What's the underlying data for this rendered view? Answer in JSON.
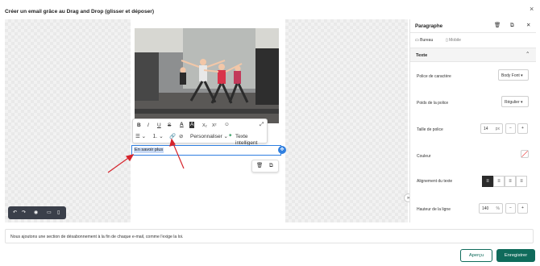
{
  "modal": {
    "title": "Créer un email grâce au Drag and Drop (glisser et déposer)",
    "close_icon": "×"
  },
  "editor": {
    "link_text": "En savoir plus",
    "toolbar": {
      "row1": [
        "B",
        "I",
        "U",
        "S",
        "A",
        "A",
        "X₂",
        "X²",
        "☺",
        "⤢"
      ],
      "personnaliser": "Personnaliser",
      "texte_intelligent": "Texte intelligent",
      "icons_row1": [
        "bold-icon",
        "italic-icon",
        "underline-icon",
        "strikethrough-icon",
        "text-color-icon",
        "highlight-icon",
        "subscript-icon",
        "superscript-icon",
        "emoji-icon",
        "expand-icon"
      ],
      "icons_row2": [
        "list-icon",
        "ordered-list-icon",
        "link-icon",
        "unlink-icon",
        "magic-wand-icon"
      ]
    }
  },
  "view_toggle": {
    "icons": [
      "undo-icon",
      "redo-icon",
      "preview-eye-icon",
      "desktop-icon",
      "mobile-icon"
    ]
  },
  "panel": {
    "title": "Paragraphe",
    "tabs": {
      "bureau": "Bureau",
      "mobile": "Mobile"
    },
    "section": "Texte",
    "fields": {
      "police": {
        "label": "Police de caractère",
        "value": "Body Font"
      },
      "poids": {
        "label": "Poids de la police",
        "value": "Régulier"
      },
      "taille": {
        "label": "Taille de police",
        "value": "14",
        "unit": "px"
      },
      "couleur": {
        "label": "Couleur"
      },
      "alignement": {
        "label": "Alignement du texte"
      },
      "hauteur": {
        "label": "Hauteur de la ligne",
        "value": "140",
        "unit": "%"
      }
    }
  },
  "footer": {
    "note": "Nous ajoutons une section de désabonnement à la fin de chaque e-mail, comme l'exige la loi.",
    "apercu": "Aperçu",
    "enregistrer": "Enregistrer"
  },
  "colors": {
    "accent": "#0f6b5b",
    "selection": "#2f7fe0",
    "annotation": "#d6242c"
  }
}
